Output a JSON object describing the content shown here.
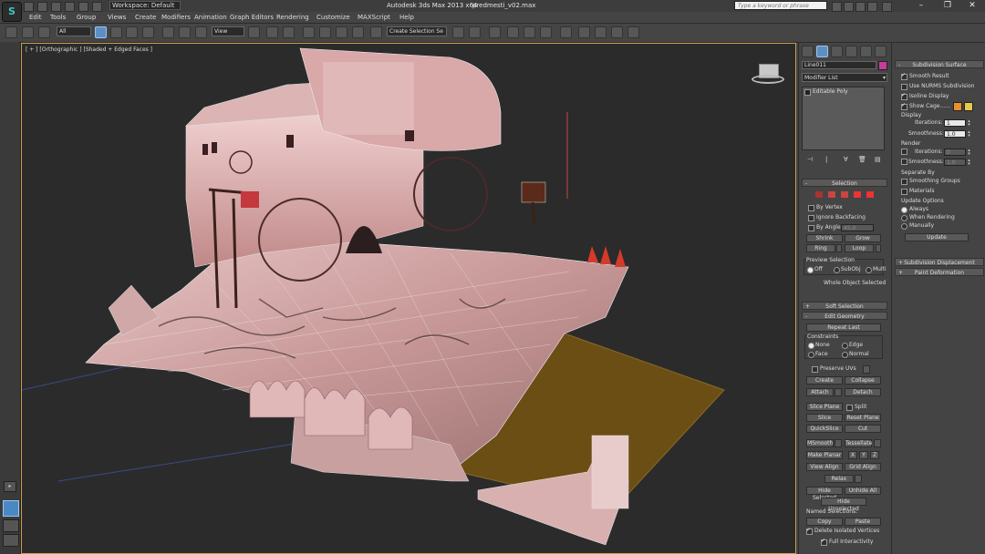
{
  "window": {
    "app_title": "Autodesk 3ds Max  2013 x64",
    "file_name": "predmesti_v02.max",
    "workspace": "Workspace: Default",
    "search_placeholder": "Type a keyword or phrase",
    "minimize": "–",
    "maximize": "❐",
    "close": "✕"
  },
  "menu": [
    "Edit",
    "Tools",
    "Group",
    "Views",
    "Create",
    "Modifiers",
    "Animation",
    "Graph Editors",
    "Rendering",
    "Customize",
    "MAXScript",
    "Help"
  ],
  "toolbar": {
    "selection_filter": "All",
    "ref_coord": "View",
    "named_selection": "Create Selection Se"
  },
  "viewport": {
    "label": "[ + ] [Orthographic ] [Shaded + Edged Faces ]"
  },
  "command_panel": {
    "object_name": "Line011",
    "object_color": "#c83ca0",
    "modifier_list": "Modifier List",
    "stack": [
      "Editable Poly"
    ],
    "selection": {
      "header": "Selection",
      "by_vertex": "By Vertex",
      "ignore_backfacing": "Ignore Backfacing",
      "by_angle": "By Angle:",
      "angle_value": "45.0",
      "shrink": "Shrink",
      "grow": "Grow",
      "ring": "Ring",
      "loop": "Loop",
      "preview_header": "Preview Selection",
      "preview_off": "Off",
      "preview_subobj": "SubObj",
      "preview_multi": "Multi",
      "status": "Whole Object Selected"
    },
    "soft_selection": "Soft Selection",
    "edit_geometry": {
      "header": "Edit Geometry",
      "repeat_last": "Repeat Last",
      "constraints": "Constraints",
      "none": "None",
      "edge": "Edge",
      "face": "Face",
      "normal": "Normal",
      "preserve_uvs": "Preserve UVs",
      "create": "Create",
      "collapse": "Collapse",
      "attach": "Attach",
      "detach": "Detach",
      "slice_plane": "Slice Plane",
      "split": "Split",
      "slice": "Slice",
      "reset_plane": "Reset Plane",
      "quickslice": "QuickSlice",
      "cut": "Cut",
      "msmooth": "MSmooth",
      "tessellate": "Tessellate",
      "make_planar": "Make Planar",
      "x": "X",
      "y": "Y",
      "z": "Z",
      "view_align": "View Align",
      "grid_align": "Grid Align",
      "relax": "Relax",
      "hide_selected": "Hide Selected",
      "unhide_all": "Unhide All",
      "hide_unselected": "Hide Unselected",
      "named_selections": "Named Selections:",
      "copy": "Copy",
      "paste": "Paste",
      "delete_isolated": "Delete Isolated Vertices",
      "full_interactivity": "Full Interactivity"
    }
  },
  "modifier_panel": {
    "header": "Subdivision Surface",
    "smooth_result": "Smooth Result",
    "use_nurms": "Use NURMS Subdivision",
    "isoline_display": "Isoline Display",
    "show_cage": "Show Cage......",
    "cage_color_1": "#e8902a",
    "cage_color_2": "#e8c84a",
    "display_header": "Display",
    "iterations_label": "Iterations:",
    "iterations_value": "1",
    "smoothness_label": "Smoothness:",
    "smoothness_value": "1.0",
    "render_header": "Render",
    "r_iterations_label": "Iterations:",
    "r_iterations_value": "0",
    "r_smoothness_label": "Smoothness:",
    "r_smoothness_value": "1.0",
    "separate_by": "Separate By",
    "smoothing_groups": "Smoothing Groups",
    "materials": "Materials",
    "update_options": "Update Options",
    "always": "Always",
    "when_rendering": "When Rendering",
    "manually": "Manually",
    "update": "Update",
    "subdivision_displacement": "Subdivision Displacement",
    "paint_deformation": "Paint Deformation"
  }
}
